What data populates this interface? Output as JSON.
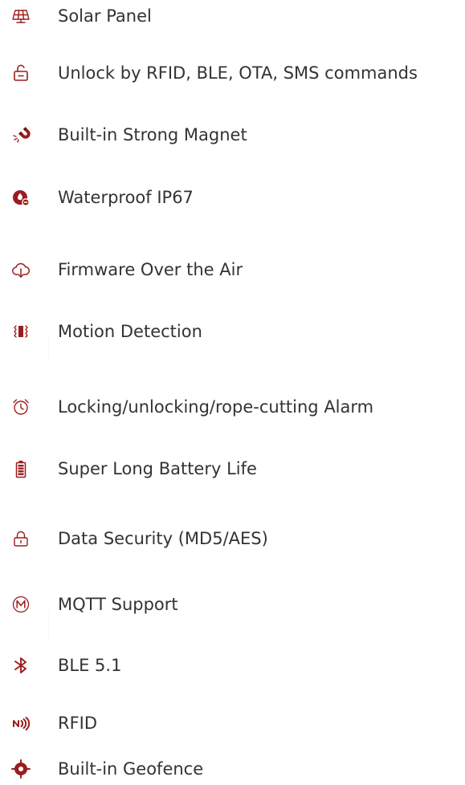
{
  "colors": {
    "accent": "#9b1c1f",
    "text": "#333333",
    "background": "#ffffff"
  },
  "features": [
    {
      "label": "Solar Panel",
      "icon": "solar-panel-icon"
    },
    {
      "label": "Unlock by RFID, BLE, OTA, SMS commands",
      "icon": "unlock-icon"
    },
    {
      "label": "Built-in Strong Magnet",
      "icon": "magnet-icon"
    },
    {
      "label": "Waterproof IP67",
      "icon": "waterproof-icon"
    },
    {
      "label": "Firmware Over the Air",
      "icon": "cloud-download-icon"
    },
    {
      "label": "Motion Detection",
      "icon": "motion-icon"
    },
    {
      "label": "Locking/unlocking/rope-cutting Alarm",
      "icon": "alarm-clock-icon"
    },
    {
      "label": "Super Long Battery Life",
      "icon": "battery-icon"
    },
    {
      "label": "Data Security (MD5/AES)",
      "icon": "lock-icon"
    },
    {
      "label": "MQTT Support",
      "icon": "mqtt-icon"
    },
    {
      "label": "BLE 5.1",
      "icon": "bluetooth-icon"
    },
    {
      "label": "RFID",
      "icon": "rfid-icon"
    },
    {
      "label": "Built-in Geofence",
      "icon": "geofence-icon"
    }
  ]
}
